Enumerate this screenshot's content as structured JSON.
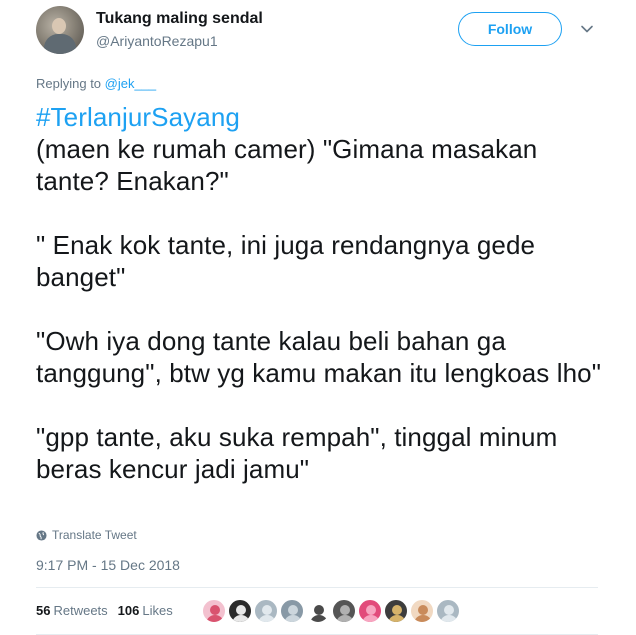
{
  "author": {
    "name": "Tukang maling sendal",
    "handle": "@AriyantoRezapu1"
  },
  "follow_label": "Follow",
  "replying": {
    "prefix": "Replying to ",
    "mention": "@jek___"
  },
  "tweet": {
    "hashtag": "#TerlanjurSayang",
    "body": "\n(maen ke rumah camer) \"Gimana masakan tante? Enakan?\"\n\n\" Enak kok tante, ini juga rendangnya gede banget\"\n\n\"Owh iya dong tante kalau beli bahan ga tanggung\", btw yg kamu makan itu lengkoas lho\"\n\n\"gpp tante, aku suka rempah\", tinggal minum beras kencur jadi jamu\""
  },
  "translate_label": "Translate Tweet",
  "timestamp": "9:17 PM - 15 Dec 2018",
  "stats": {
    "retweets_count": "56",
    "retweets_label": "Retweets",
    "likes_count": "106",
    "likes_label": "Likes"
  },
  "liker_avatars": [
    {
      "color": "#f3c1cf",
      "accent": "#d9536f"
    },
    {
      "color": "#2b2b2b",
      "accent": "#e8e8e8"
    },
    {
      "color": "#aab8c2",
      "accent": "#e1e8ed"
    },
    {
      "color": "#8899a6",
      "accent": "#ccd6dd"
    },
    {
      "color": "#ffffff",
      "accent": "#4a4a4a"
    },
    {
      "color": "#555555",
      "accent": "#b0b0b0"
    },
    {
      "color": "#e24b7b",
      "accent": "#f7a6c1"
    },
    {
      "color": "#3d3d3d",
      "accent": "#d6b36a"
    },
    {
      "color": "#f1d9c2",
      "accent": "#c98b5b"
    },
    {
      "color": "#aab8c2",
      "accent": "#e1e8ed"
    }
  ]
}
